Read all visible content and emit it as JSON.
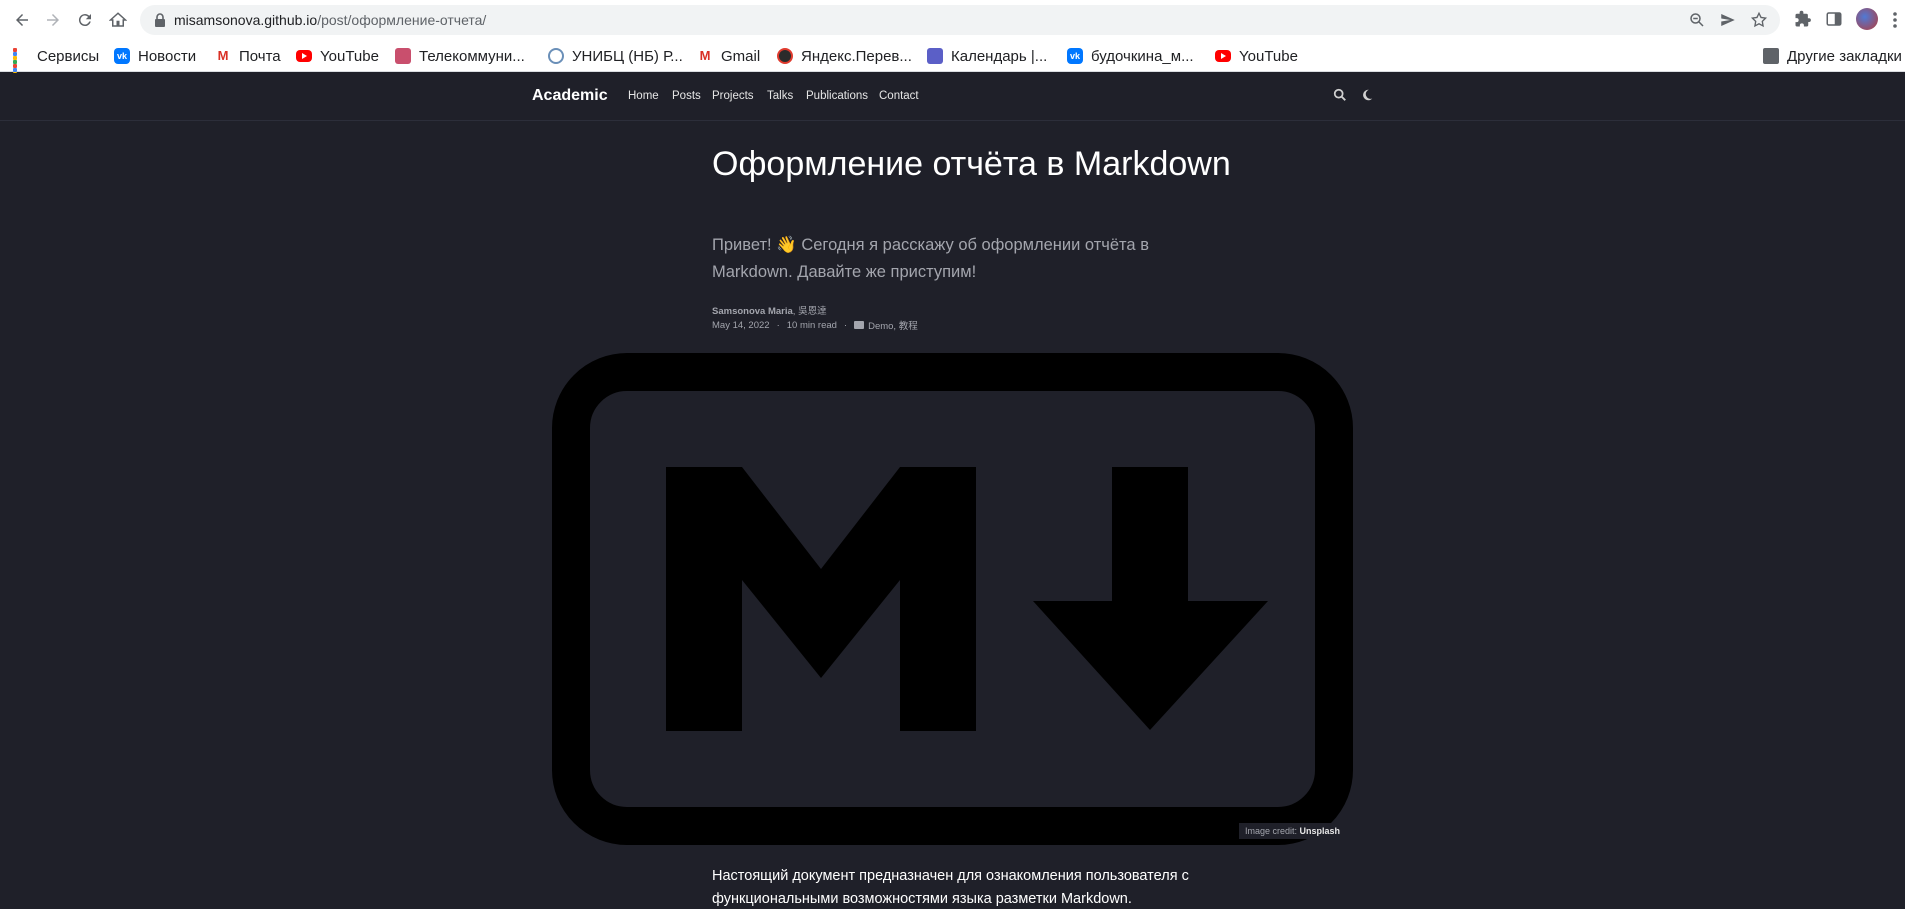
{
  "browser": {
    "url_host": "misamsonova.github.io",
    "url_path": "/post/оформление-отчета/"
  },
  "bookmarks": [
    {
      "label": "Сервисы",
      "icon": "apps-grid-icon"
    },
    {
      "label": "Новости",
      "icon": "vk-icon"
    },
    {
      "label": "Почта",
      "icon": "gmail-icon"
    },
    {
      "label": "YouTube",
      "icon": "youtube-icon"
    },
    {
      "label": "Телекоммуни...",
      "icon": "site-icon"
    },
    {
      "label": "УНИБЦ (НБ) Р...",
      "icon": "site-icon"
    },
    {
      "label": "Gmail",
      "icon": "gmail-icon"
    },
    {
      "label": "Яндекс.Перев...",
      "icon": "yandex-icon"
    },
    {
      "label": "Календарь |...",
      "icon": "teams-icon"
    },
    {
      "label": "будочкина_м...",
      "icon": "vk-icon"
    },
    {
      "label": "YouTube",
      "icon": "youtube-icon"
    }
  ],
  "other_bookmarks": "Другие закладки",
  "site": {
    "brand": "Academic",
    "menu": [
      "Home",
      "Posts",
      "Projects",
      "Talks",
      "Publications",
      "Contact"
    ]
  },
  "post": {
    "title": "Оформление отчёта в Markdown",
    "summary": "Привет! 👋 Сегодня я расскажу об оформлении отчёта в Markdown. Давайте же приступим!",
    "author_main": "Samsonova Maria",
    "author_sep": ", ",
    "author_second": "吳恩達",
    "date": "May 14, 2022",
    "read_time": "10 min read",
    "categories": "Demo, 教程",
    "image_credit_label": "Image credit: ",
    "image_credit_source": "Unsplash",
    "body": "Настоящий документ предназначен для ознакомления пользователя с функциональными возможностями языка разметки Markdown."
  }
}
